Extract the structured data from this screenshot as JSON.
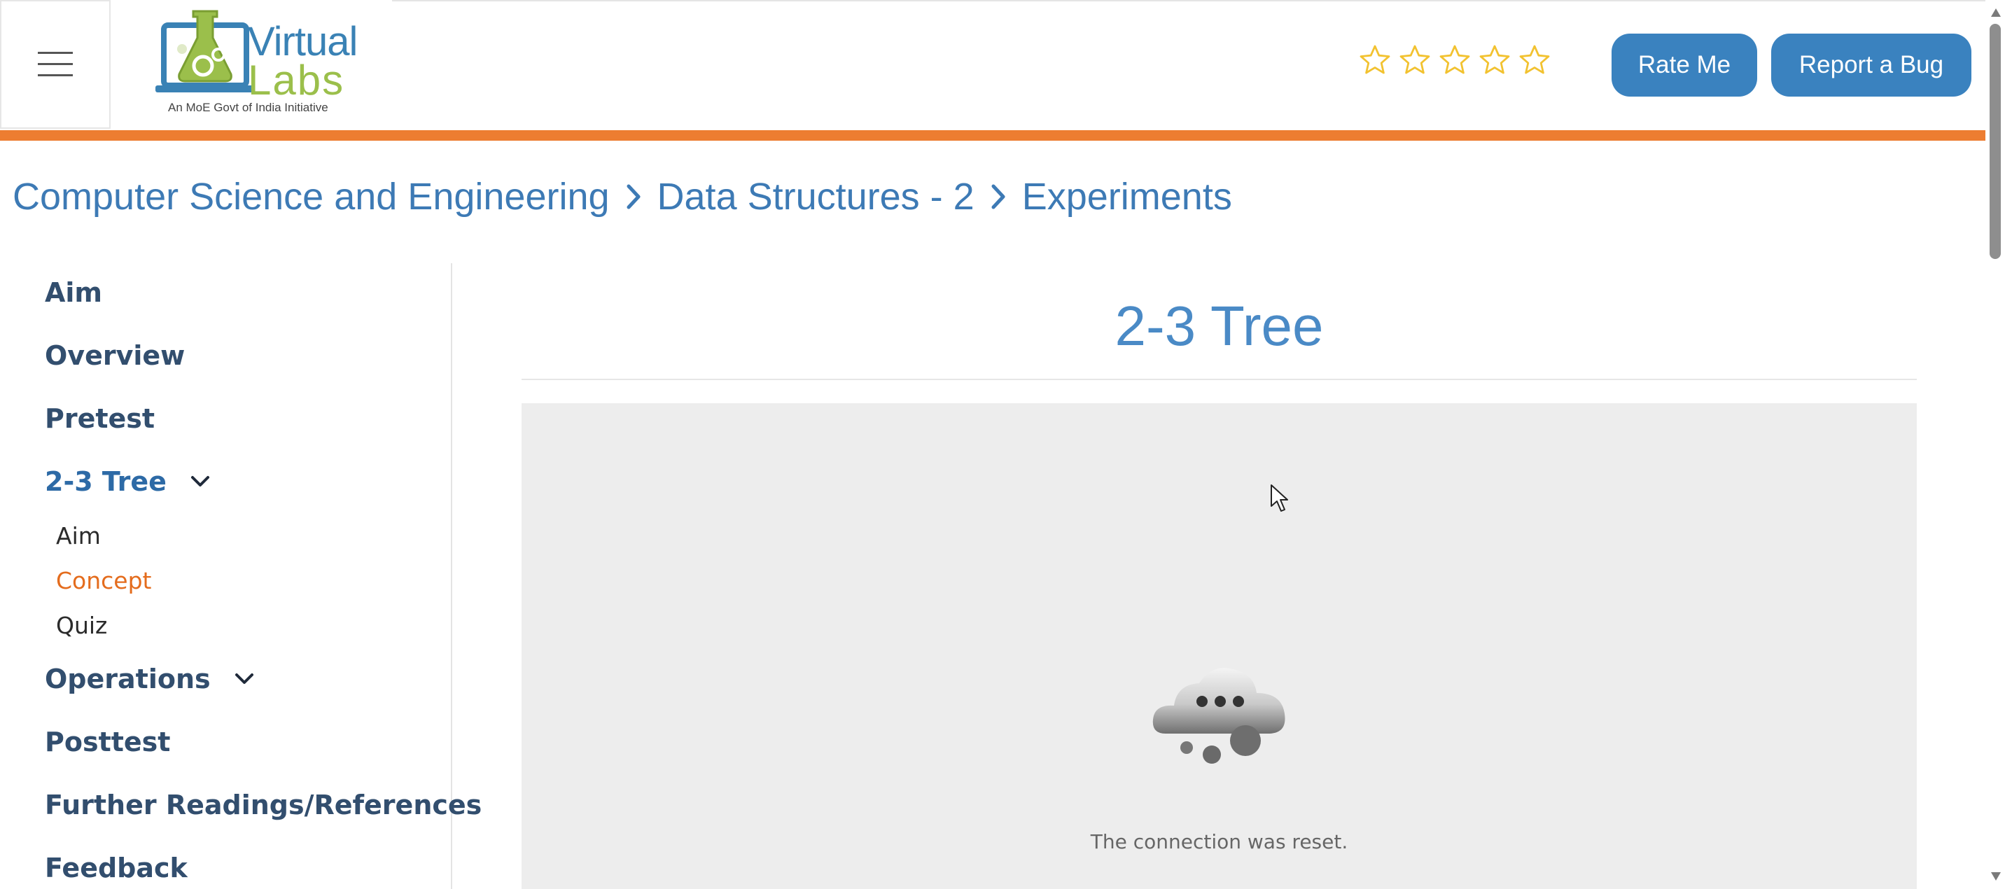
{
  "header": {
    "menu_icon": "hamburger-menu-icon",
    "logo": {
      "word1": "Virtual",
      "word2": "Labs",
      "tagline": "An MoE Govt of India Initiative"
    },
    "rating": {
      "max": 5,
      "value": 0,
      "icon": "star-outline-icon",
      "color": "#f2c230"
    },
    "rate_button": "Rate Me",
    "bug_button": "Report a Bug",
    "accent_color": "#ed7d31",
    "button_color": "#3a82bf"
  },
  "breadcrumb": {
    "items": [
      "Computer Science and Engineering",
      "Data Structures - 2",
      "Experiments"
    ],
    "separator_icon": "chevron-right-icon"
  },
  "sidebar": {
    "items": [
      {
        "label": "Aim"
      },
      {
        "label": "Overview"
      },
      {
        "label": "Pretest"
      },
      {
        "label": "2-3 Tree",
        "expanded": true,
        "children": [
          {
            "label": "Aim"
          },
          {
            "label": "Concept",
            "active": true
          },
          {
            "label": "Quiz"
          }
        ]
      },
      {
        "label": "Operations",
        "expanded": false
      },
      {
        "label": "Posttest"
      },
      {
        "label": "Further Readings/References"
      },
      {
        "label": "Feedback"
      }
    ],
    "active_color": "#e46c1d"
  },
  "main": {
    "title": "2-3 Tree",
    "frame": {
      "icon": "cloud-error-icon",
      "message": "The connection was reset."
    }
  }
}
